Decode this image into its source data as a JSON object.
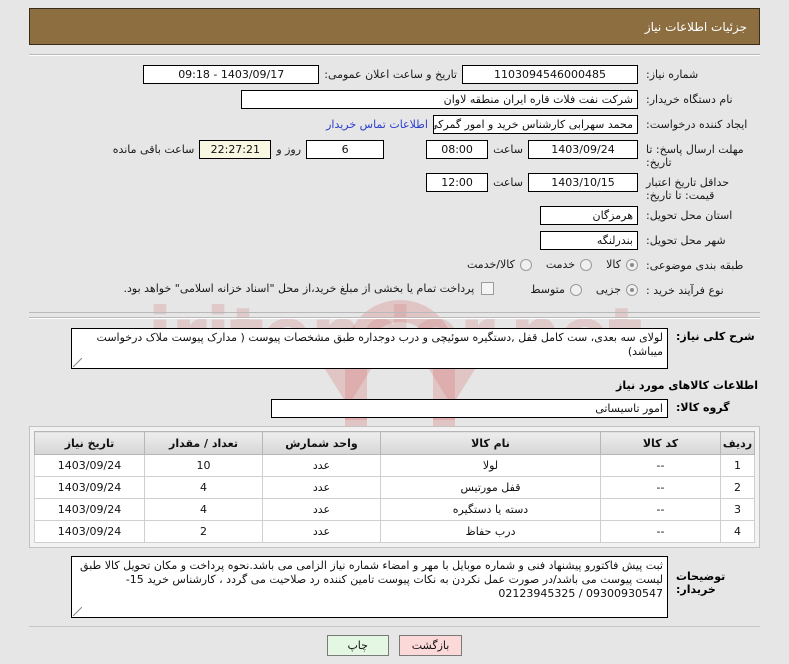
{
  "header": {
    "title": "جزئیات اطلاعات نیاز"
  },
  "form": {
    "need_number_label": "شماره نیاز:",
    "need_number_value": "1103094546000485",
    "announce_label": "تاریخ و ساعت اعلان عمومی:",
    "announce_value": "1403/09/17 - 09:18",
    "buyer_org_label": "نام دستگاه خریدار:",
    "buyer_org_value": "شرکت نفت فلات قاره ایران منطقه لاوان",
    "creator_label": "ایجاد کننده درخواست:",
    "creator_value": "محمد سهرابی کارشناس خرید و امور گمرکی شرکت نفت فلات قاره ایران منطقه",
    "contact_link": "اطلاعات تماس خریدار",
    "reply_deadline_label": "مهلت ارسال پاسخ: تا تاریخ:",
    "reply_deadline_date": "1403/09/24",
    "time_label": "ساعت",
    "reply_deadline_time": "08:00",
    "days_value": "6",
    "days_label": "روز و",
    "countdown_value": "22:27:21",
    "countdown_label": "ساعت باقی مانده",
    "price_validity_label": "حداقل تاریخ اعتبار قیمت: تا تاریخ:",
    "price_validity_date": "1403/10/15",
    "price_validity_time": "12:00",
    "province_label": "استان محل تحویل:",
    "province_value": "هرمزگان",
    "city_label": "شهر محل تحویل:",
    "city_value": "بندرلنگه",
    "category_label": "طبقه بندی موضوعی:",
    "category_options": [
      {
        "label": "کالا",
        "selected": true
      },
      {
        "label": "خدمت",
        "selected": false
      },
      {
        "label": "کالا/خدمت",
        "selected": false
      }
    ],
    "process_label": "نوع فرآیند خرید :",
    "process_options": [
      {
        "label": "جزیی",
        "selected": true
      },
      {
        "label": "متوسط",
        "selected": false
      }
    ],
    "treasury_checkbox_label": "پرداخت تمام یا بخشی از مبلغ خرید،از محل \"اسناد خزانه اسلامی\" خواهد بود.",
    "treasury_checked": false
  },
  "description": {
    "label": "شرح کلی نیاز:",
    "value": "لولای سه بعدی، ست کامل قفل ,دستگیره سوئیچی و درب دوجداره طبق مشخصات پیوست ( مدارک پیوست ملاک درخواست میباشد)"
  },
  "goods_section": {
    "title": "اطلاعات کالاهای مورد نیاز",
    "group_label": "گروه کالا:",
    "group_value": "امور تاسیساتی",
    "columns": [
      "ردیف",
      "کد کالا",
      "نام کالا",
      "واحد شمارش",
      "تعداد / مقدار",
      "تاریخ نیاز"
    ],
    "rows": [
      {
        "radif": "1",
        "code": "--",
        "name": "لولا",
        "unit": "عدد",
        "qty": "10",
        "date": "1403/09/24"
      },
      {
        "radif": "2",
        "code": "--",
        "name": "قفل مورتیس",
        "unit": "عدد",
        "qty": "4",
        "date": "1403/09/24"
      },
      {
        "radif": "3",
        "code": "--",
        "name": "دسته یا دستگیره",
        "unit": "عدد",
        "qty": "4",
        "date": "1403/09/24"
      },
      {
        "radif": "4",
        "code": "--",
        "name": "درب حفاظ",
        "unit": "عدد",
        "qty": "2",
        "date": "1403/09/24"
      }
    ]
  },
  "buyer_notes": {
    "label": "توضیحات خریدار:",
    "value": "ثبت پیش فاکتورو پیشنهاد فنی و شماره موبایل با مهر و امضاء شماره نیاز الزامی می باشد.نحوه پرداخت و مکان تحویل کالا طبق لیست پیوست می باشد/در صورت عمل نکردن به نکات پیوست تامین کننده رد صلاحیت می گردد ، کارشناس خرید 15-09300930547 / 02123945325"
  },
  "footer": {
    "print_label": "چاپ",
    "back_label": "بازگشت"
  },
  "watermark": {
    "text": "iritender.net"
  },
  "colors": {
    "header_bar": "#8d6e41",
    "page_bg": "#e6e6e6",
    "link": "#2a3fd0",
    "print_button": "#e3f7e3",
    "back_button": "#fbd9d9",
    "countdown_field": "#f7f7e2"
  }
}
